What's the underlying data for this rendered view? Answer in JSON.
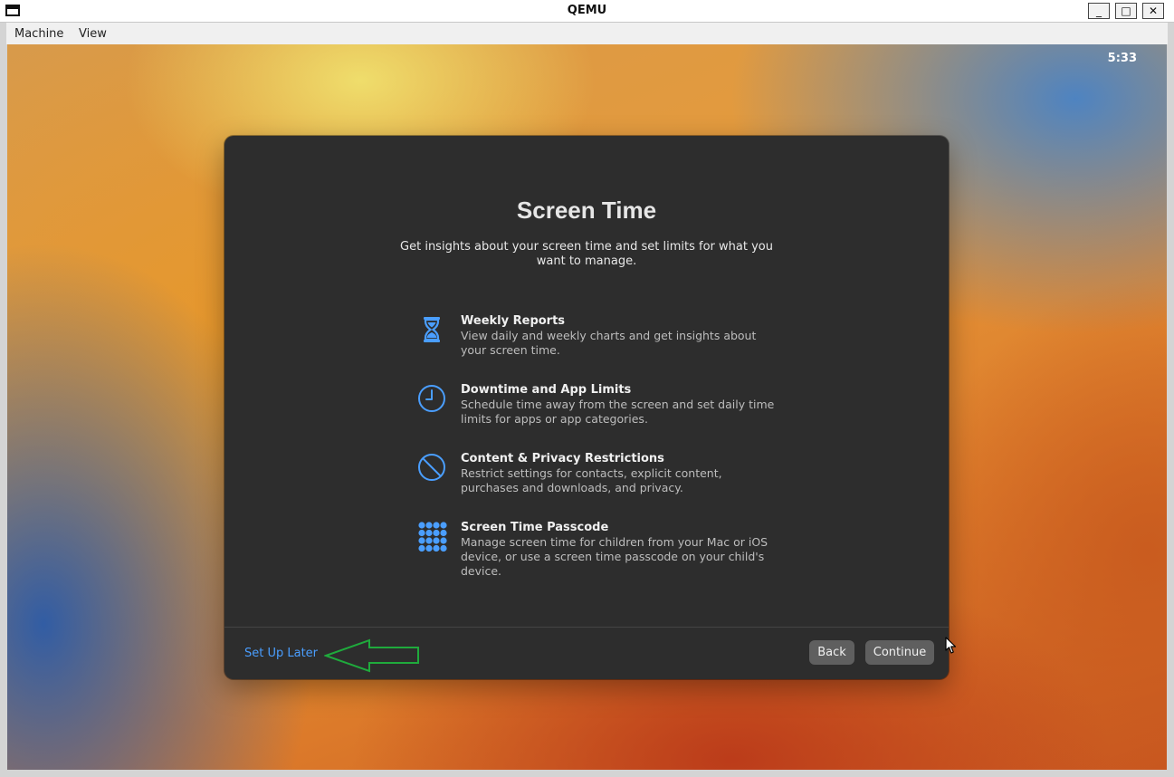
{
  "window": {
    "title": "QEMU",
    "minimize_glyph": "_",
    "maximize_glyph": "□",
    "close_glyph": "✕"
  },
  "menubar": {
    "items": [
      {
        "label": "Machine"
      },
      {
        "label": "View"
      }
    ]
  },
  "desktop": {
    "clock": "5:33"
  },
  "dialog": {
    "title": "Screen Time",
    "subtitle": "Get insights about your screen time and set limits for what you want to manage.",
    "features": [
      {
        "icon": "hourglass-icon",
        "title": "Weekly Reports",
        "description": "View daily and weekly charts and get insights about your screen time."
      },
      {
        "icon": "clock-icon",
        "title": "Downtime and App Limits",
        "description": "Schedule time away from the screen and set daily time limits for apps or app categories."
      },
      {
        "icon": "restricted-icon",
        "title": "Content & Privacy Restrictions",
        "description": "Restrict settings for contacts, explicit content, purchases and downloads, and privacy."
      },
      {
        "icon": "keypad-icon",
        "title": "Screen Time Passcode",
        "description": "Manage screen time for children from your Mac or iOS device, or use a screen time passcode on your child's device."
      }
    ],
    "setup_later_label": "Set Up Later",
    "back_label": "Back",
    "continue_label": "Continue",
    "accent_color": "#4a9eff"
  },
  "annotation": {
    "arrow_color": "#1faa3c",
    "points_to": "Set Up Later"
  }
}
